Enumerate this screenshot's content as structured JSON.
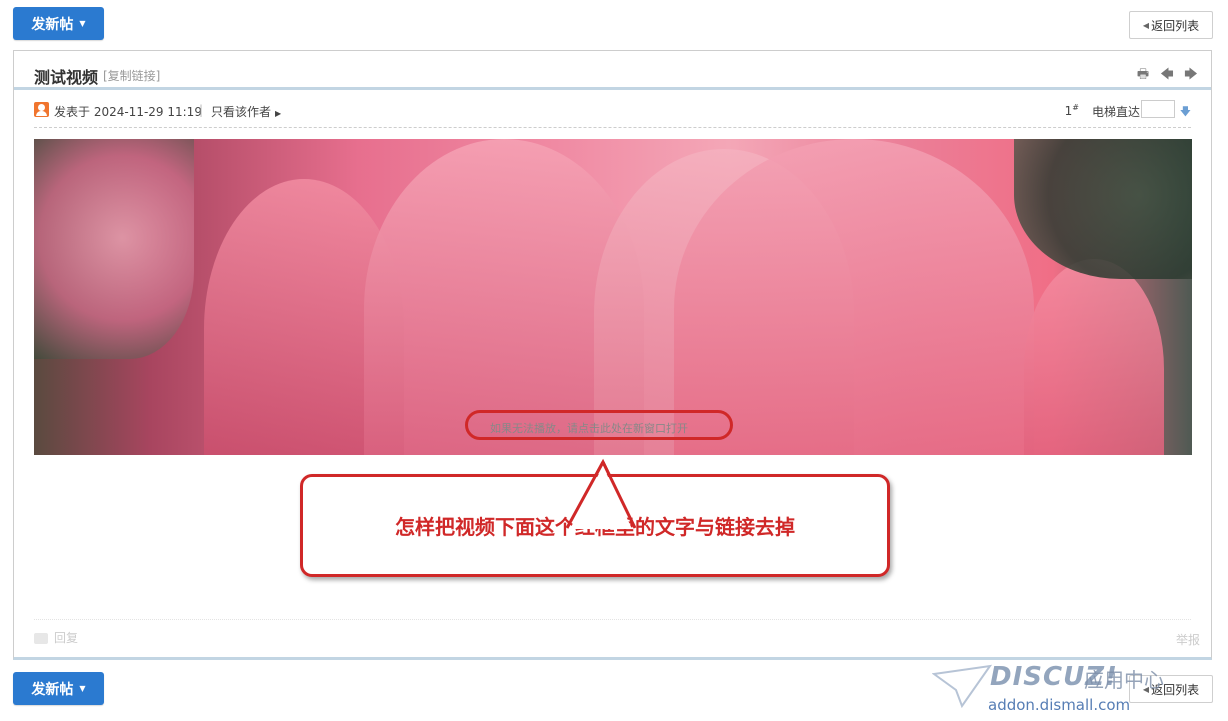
{
  "toolbar": {
    "new_post_label": "发新帖",
    "back_label": "返回列表"
  },
  "thread": {
    "title": "测试视频",
    "copy_link": "[复制链接]",
    "posted_text": "发表于 2024-11-29 11:19",
    "separator": "|",
    "only_author": "只看该作者",
    "floor": "1",
    "floor_mark": "#",
    "elevator_label": "电梯直达",
    "jump_value": ""
  },
  "video": {
    "fallback_text": "如果无法播放，请点击此处在新窗口打开"
  },
  "annotation": {
    "callout_text": "怎样把视频下面这个红框里的文字与链接去掉",
    "color": "#d02828"
  },
  "post_footer": {
    "reply_label": "回复",
    "report_label": "举报"
  },
  "watermark": {
    "logo": "DISCUZ!",
    "sub": "应用中心",
    "url": "addon.dismall.com"
  },
  "colors": {
    "accent": "#2b7ad0",
    "border_blue": "#c2d5e3"
  }
}
